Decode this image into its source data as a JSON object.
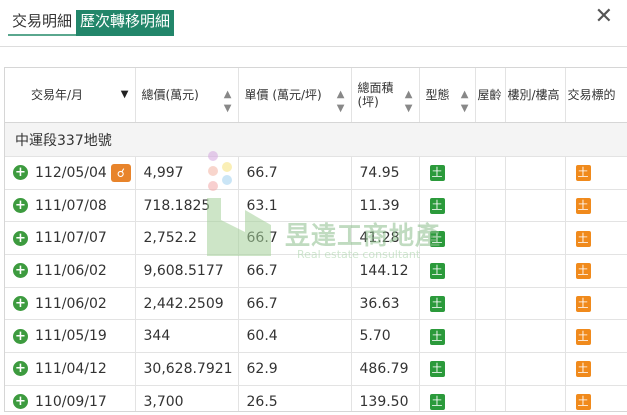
{
  "tabs": [
    {
      "label": "交易明細",
      "active": false
    },
    {
      "label": "歷次轉移明細",
      "active": true
    }
  ],
  "close_label": "✕",
  "columns": [
    {
      "label": "交易年/月",
      "sortable": true,
      "sort_active": true
    },
    {
      "label": "總價(萬元)",
      "sortable": true,
      "sort_active": false
    },
    {
      "label": "單價 (萬元/坪)",
      "sortable": true,
      "sort_active": false
    },
    {
      "label": "總面積 (坪)",
      "sortable": true,
      "sort_active": false
    },
    {
      "label": "型態",
      "sortable": true,
      "sort_active": false
    },
    {
      "label": "屋齡",
      "sortable": false,
      "sort_active": false
    },
    {
      "label": "樓別/樓高",
      "sortable": false,
      "sort_active": false
    },
    {
      "label": "交易標的",
      "sortable": false,
      "sort_active": false
    }
  ],
  "group_label": "中運段337地號",
  "rows": [
    {
      "date": "112/05/04",
      "total": "4,997",
      "unit": "66.7",
      "area": "74.95",
      "type": "土",
      "target": "土",
      "has_map": true
    },
    {
      "date": "111/07/08",
      "total": "718.1825",
      "unit": "63.1",
      "area": "11.39",
      "type": "土",
      "target": "土",
      "has_map": false
    },
    {
      "date": "111/07/07",
      "total": "2,752.2",
      "unit": "66.7",
      "area": "41.28",
      "type": "土",
      "target": "土",
      "has_map": false
    },
    {
      "date": "111/06/02",
      "total": "9,608.5177",
      "unit": "66.7",
      "area": "144.12",
      "type": "土",
      "target": "土",
      "has_map": false
    },
    {
      "date": "111/06/02",
      "total": "2,442.2509",
      "unit": "66.7",
      "area": "36.63",
      "type": "土",
      "target": "土",
      "has_map": false
    },
    {
      "date": "111/05/19",
      "total": "344",
      "unit": "60.4",
      "area": "5.70",
      "type": "土",
      "target": "土",
      "has_map": false
    },
    {
      "date": "111/04/12",
      "total": "30,628.7921",
      "unit": "62.9",
      "area": "486.79",
      "type": "土",
      "target": "土",
      "has_map": false
    },
    {
      "date": "110/09/17",
      "total": "3,700",
      "unit": "26.5",
      "area": "139.50",
      "type": "土",
      "target": "土",
      "has_map": false
    }
  ],
  "watermark": {
    "title": "昱達工商地產",
    "subtitle": "Real estate consultant"
  },
  "colors": {
    "accent": "#22866a",
    "plus": "#3d9b3f",
    "land_badge": "#2b9a3b",
    "target_badge": "#f08a1c",
    "map_icon": "#e8842b"
  }
}
